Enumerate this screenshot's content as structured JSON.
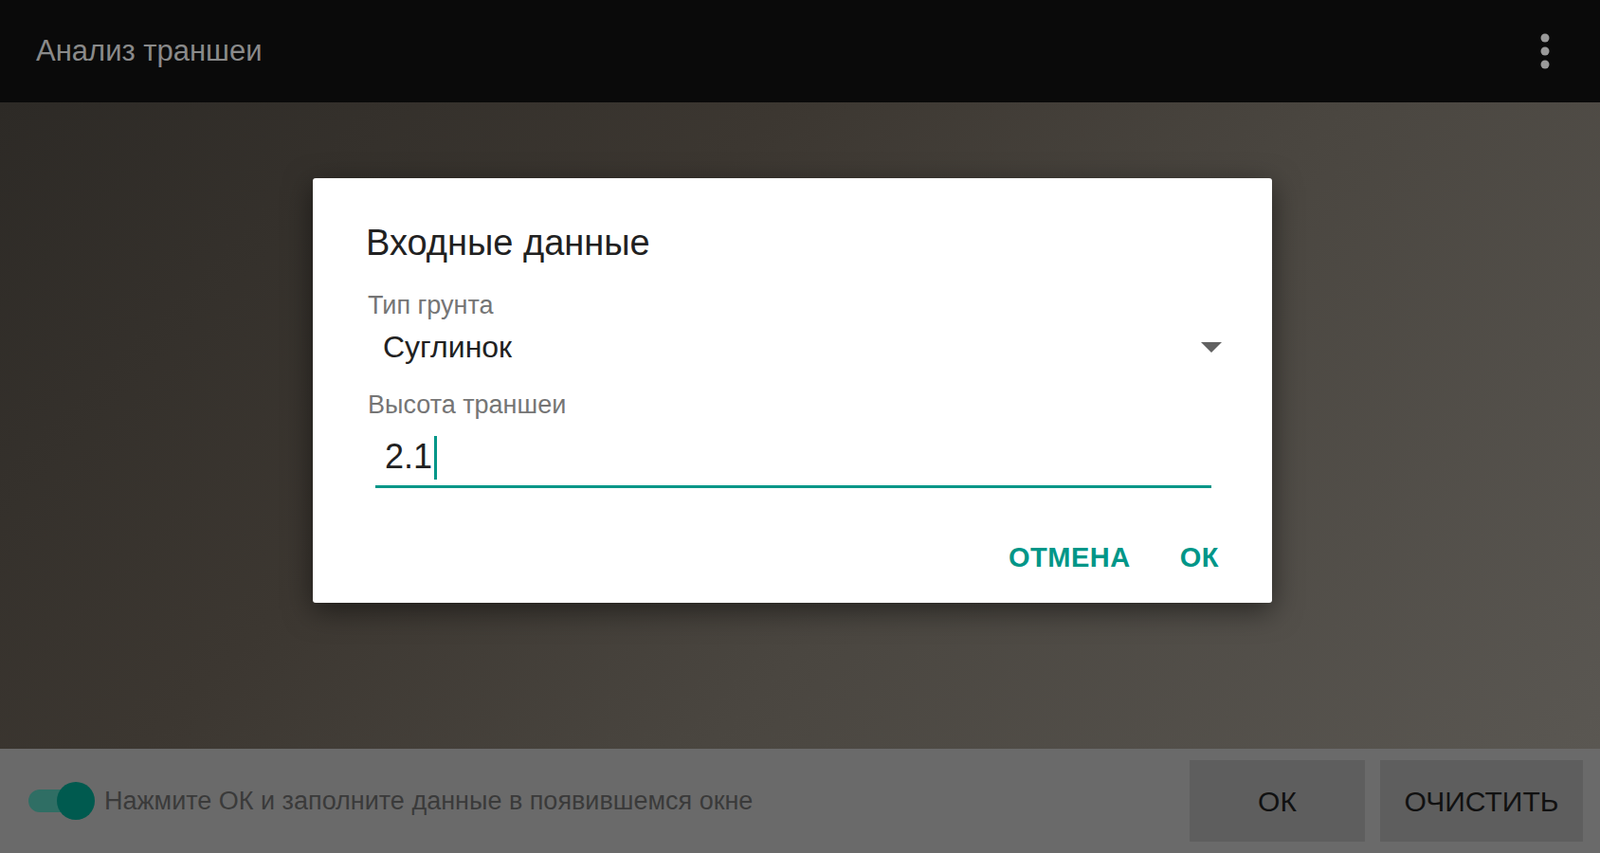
{
  "window": {
    "title": "Анализ траншеи"
  },
  "dialog": {
    "title": "Входные данные",
    "fields": [
      {
        "kind": "select",
        "label": "Тип грунта",
        "value": "Суглинок",
        "focused": false
      },
      {
        "kind": "input",
        "label": "Высота траншеи",
        "value": "2.1",
        "focused": true
      }
    ],
    "buttons": [
      "ОТМЕНА",
      "ОК"
    ]
  },
  "bottom_bar": {
    "switch": {
      "on": true
    },
    "hint": "Нажмите ОК и заполните данные в появившемся окне",
    "buttons": [
      "ОК",
      "ОЧИСТИТЬ"
    ]
  }
}
